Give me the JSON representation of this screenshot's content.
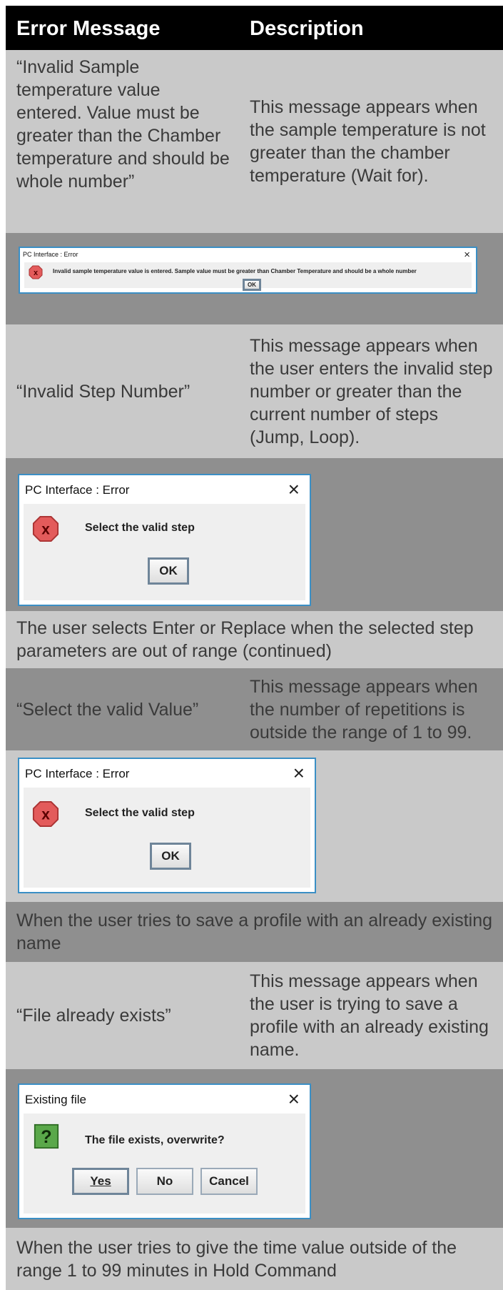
{
  "header": {
    "col1": "Error Message",
    "col2": "Description"
  },
  "rows": [
    {
      "message": "“Invalid Sample temperature value entered. Value must be greater than the Chamber temperature and should be whole number”",
      "description": "This message appears when the sample temperature is not greater than the chamber temperature (Wait for).",
      "dialog": {
        "title": "PC Interface : Error",
        "close": "×",
        "icon": "error-icon",
        "icon_glyph": "x",
        "text": "Invalid sample temperature value is entered. Sample value must be greater than Chamber Temperature and should be a whole number",
        "buttons": [
          "OK"
        ]
      }
    },
    {
      "message": "“Invalid Step Number”",
      "description": "This message appears when the user enters the invalid step number or greater than the current number of steps (Jump, Loop).",
      "dialog": {
        "title": "PC Interface : Error",
        "close": "×",
        "icon": "error-icon",
        "icon_glyph": "x",
        "text": "Select the valid step",
        "buttons": [
          "OK"
        ]
      }
    },
    {
      "section": "The user selects Enter or Replace when the selected step parameters are out of range (continued)"
    },
    {
      "message": "“Select the valid Value”",
      "description": "This message appears when the number of repetitions is outside the range of 1 to 99.",
      "dialog": {
        "title": "PC Interface : Error",
        "close": "×",
        "icon": "error-icon",
        "icon_glyph": "x",
        "text": "Select the valid step",
        "buttons": [
          "OK"
        ]
      }
    },
    {
      "section": "When the user tries to save a profile with an already existing name"
    },
    {
      "message": "“File already exists”",
      "description": "This message appears when the user is trying to save a profile with an already existing name.",
      "dialog": {
        "title": "Existing file",
        "close": "×",
        "icon": "question-icon",
        "icon_glyph": "?",
        "text": "The file exists, overwrite?",
        "buttons": [
          "Yes",
          "No",
          "Cancel"
        ]
      }
    },
    {
      "section": "When the user tries to give the time value outside of the range 1 to 99 minutes in Hold Command"
    }
  ],
  "colors": {
    "header_bg": "#000000",
    "row_light": "#c9c9c9",
    "row_dark": "#8f8f8f",
    "dialog_border": "#3b8fc5",
    "error_icon": "#e35b5b",
    "question_icon": "#5aa84a"
  }
}
